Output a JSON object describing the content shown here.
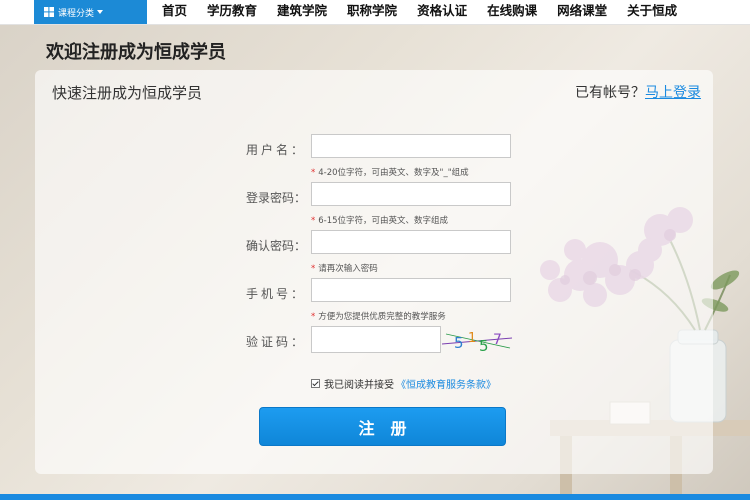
{
  "nav": {
    "category_label": "课程分类",
    "items": [
      "首页",
      "学历教育",
      "建筑学院",
      "职称学院",
      "资格认证",
      "在线购课",
      "网络课堂",
      "关于恒成"
    ]
  },
  "page_title": "欢迎注册成为恒成学员",
  "panel": {
    "title": "快速注册成为恒成学员",
    "login_prompt": "已有帐号？",
    "login_link": "马上登录"
  },
  "form": {
    "username": {
      "label": "用户名：",
      "hint": "4-20位字符，可由英文、数字及\"_\"组成",
      "value": ""
    },
    "password": {
      "label": "登录密码：",
      "hint": "6-15位字符，可由英文、数字组成",
      "value": ""
    },
    "confirm": {
      "label": "确认密码：",
      "hint": "请再次输入密码",
      "value": ""
    },
    "phone": {
      "label": "手机号：",
      "hint": "方便为您提供优质完整的教学服务",
      "value": ""
    },
    "captcha": {
      "label": "验证码：",
      "value": "",
      "image_text": "5157"
    },
    "hint_mark": "*"
  },
  "agree": {
    "text": "我已阅读并接受",
    "terms": "《恒成教育服务条款》",
    "checked": true
  },
  "submit_label": "注册",
  "colors": {
    "accent": "#1a8ae0",
    "required": "#e03030"
  }
}
